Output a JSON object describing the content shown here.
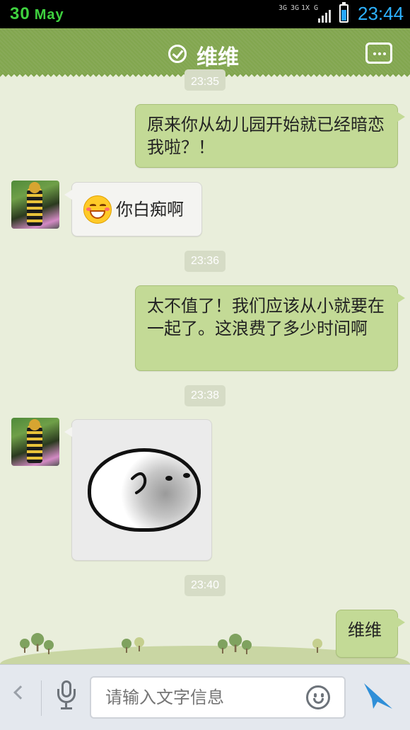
{
  "status_bar": {
    "date_day": "30",
    "date_month": "May",
    "network_labels": [
      "3G",
      "3G",
      "1X",
      "G"
    ],
    "battery_level_percent": 70,
    "time": "23:44"
  },
  "header": {
    "title": "维维"
  },
  "messages": [
    {
      "type": "timestamp",
      "text": "23:35"
    },
    {
      "type": "outgoing",
      "text": "原来你从幼儿园开始就已经暗恋我啦？！"
    },
    {
      "type": "incoming",
      "emoji": "grinning-squint-emoji",
      "text": "你白痴啊"
    },
    {
      "type": "timestamp",
      "text": "23:36"
    },
    {
      "type": "outgoing",
      "text": "太不值了！我们应该从小就要在一起了。这浪费了多少时间啊"
    },
    {
      "type": "timestamp",
      "text": "23:38"
    },
    {
      "type": "incoming",
      "sticker": "round-blob-face-sticker"
    },
    {
      "type": "timestamp",
      "text": "23:40"
    },
    {
      "type": "outgoing",
      "text": "维维"
    }
  ],
  "input_bar": {
    "placeholder": "请输入文字信息",
    "icons": [
      "chevron-left-icon",
      "microphone-icon",
      "smiley-icon",
      "send-icon"
    ]
  },
  "colors": {
    "header_green": "#82a64f",
    "outgoing_bubble": "#c3da96",
    "incoming_bubble": "#f4f4f1",
    "chat_background": "#e9eedb",
    "time_blue": "#2db1ff"
  }
}
